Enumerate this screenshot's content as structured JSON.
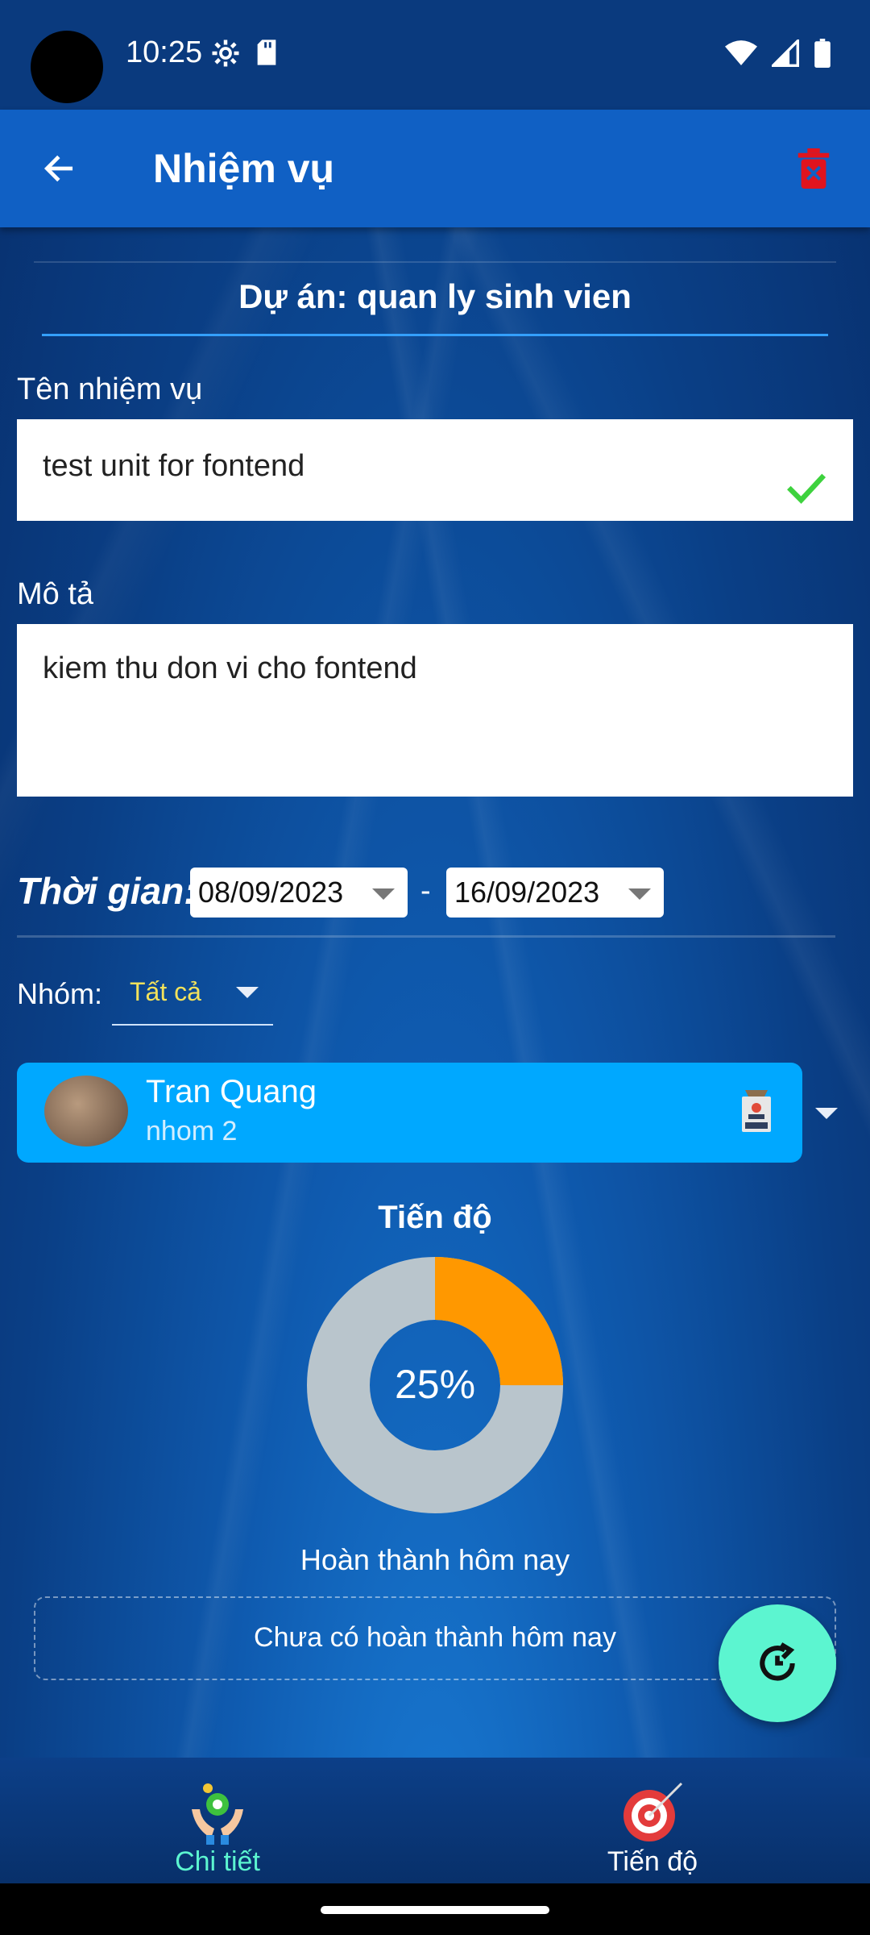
{
  "status_bar": {
    "time": "10:25",
    "left_icons": [
      "settings-icon",
      "sd-card-icon"
    ],
    "right_icons": [
      "wifi-icon",
      "signal-icon",
      "battery-icon"
    ]
  },
  "app_bar": {
    "title": "Nhiệm vụ",
    "back_icon": "arrow-left-icon",
    "delete_icon": "trash-icon",
    "delete_color": "#e0141e"
  },
  "project": {
    "label": "Dự án: quan ly sinh vien"
  },
  "task_name": {
    "label": "Tên nhiệm vụ",
    "value": "test unit for fontend",
    "valid_icon": "checkmark-icon",
    "valid_color": "#3ed23e"
  },
  "description": {
    "label": "Mô tả",
    "value": "kiem thu don vi cho fontend"
  },
  "time_range": {
    "label": "Thời gian:",
    "start": "08/09/2023",
    "separator": "-",
    "end": "16/09/2023"
  },
  "group": {
    "label": "Nhóm:",
    "selected": "Tất cả"
  },
  "member": {
    "name": "Tran Quang",
    "group": "nhom 2",
    "role_icon": "staff-badge-icon"
  },
  "progress": {
    "title": "Tiến độ",
    "percent_label": "25%",
    "percent": 25,
    "complete_color": "#ff9800",
    "remaining_color": "#b9c5cc"
  },
  "today": {
    "title": "Hoàn thành hôm nay",
    "empty_text": "Chưa có hoàn thành hôm nay"
  },
  "fab": {
    "icon": "refresh-clock-icon",
    "color": "#5cf5d0"
  },
  "bottom_nav": {
    "items": [
      {
        "label": "Chi tiết",
        "icon": "hands-gear-icon",
        "active": true
      },
      {
        "label": "Tiến độ",
        "icon": "target-icon",
        "active": false
      }
    ],
    "active_color": "#5cf5d0",
    "inactive_color": "#ffffff"
  }
}
